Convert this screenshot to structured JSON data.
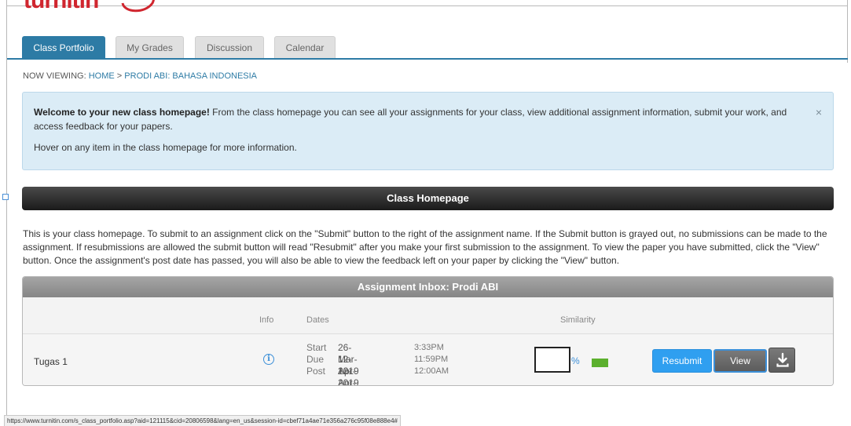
{
  "logo": {
    "text": "turnitin"
  },
  "tabs": [
    {
      "label": "Class Portfolio",
      "active": true
    },
    {
      "label": "My Grades",
      "active": false
    },
    {
      "label": "Discussion",
      "active": false
    },
    {
      "label": "Calendar",
      "active": false
    }
  ],
  "breadcrumb": {
    "prefix": "NOW VIEWING:",
    "home": "HOME",
    "separator": ">",
    "current": "PRODI ABI: BAHASA INDONESIA"
  },
  "welcome": {
    "bold": "Welcome to your new class homepage!",
    "text": " From the class homepage you can see all your assignments for your class, view additional assignment information, submit your work, and access feedback for your papers.",
    "hover_text": "Hover on any item in the class homepage for more information.",
    "close": "×"
  },
  "class_homepage": {
    "title": "Class Homepage",
    "description": "This is your class homepage. To submit to an assignment click on the \"Submit\" button to the right of the assignment name. If the Submit button is grayed out, no submissions can be made to the assignment. If resubmissions are allowed the submit button will read \"Resubmit\" after you make your first submission to the assignment. To view the paper you have submitted, click the \"View\" button. Once the assignment's post date has passed, you will also be able to view the feedback left on your paper by clicking the \"View\" button."
  },
  "inbox": {
    "title": "Assignment Inbox: Prodi ABI",
    "columns": {
      "info": "Info",
      "dates": "Dates",
      "similarity": "Similarity"
    },
    "assignment": {
      "name": "Tugas 1",
      "info_icon": "ⓘ",
      "dates": [
        {
          "label": "Start",
          "date": "26-Mar-2019",
          "time": "3:33PM"
        },
        {
          "label": "Due",
          "date": "12-Apr-2019",
          "time": "11:59PM"
        },
        {
          "label": "Post",
          "date": "12-Apr-2019",
          "time": "12:00AM"
        }
      ],
      "similarity_value": "",
      "similarity_symbol": "%",
      "similarity_color": "#5cb02e",
      "resubmit_label": "Resubmit",
      "view_label": "View",
      "download_icon": "download-icon"
    }
  },
  "status_url": "https://www.turnitin.com/s_class_portfolio.asp?aid=121115&cid=20806598&lang=en_us&session-id=cbef71a4ae71e356a276c95f08e888e4#"
}
